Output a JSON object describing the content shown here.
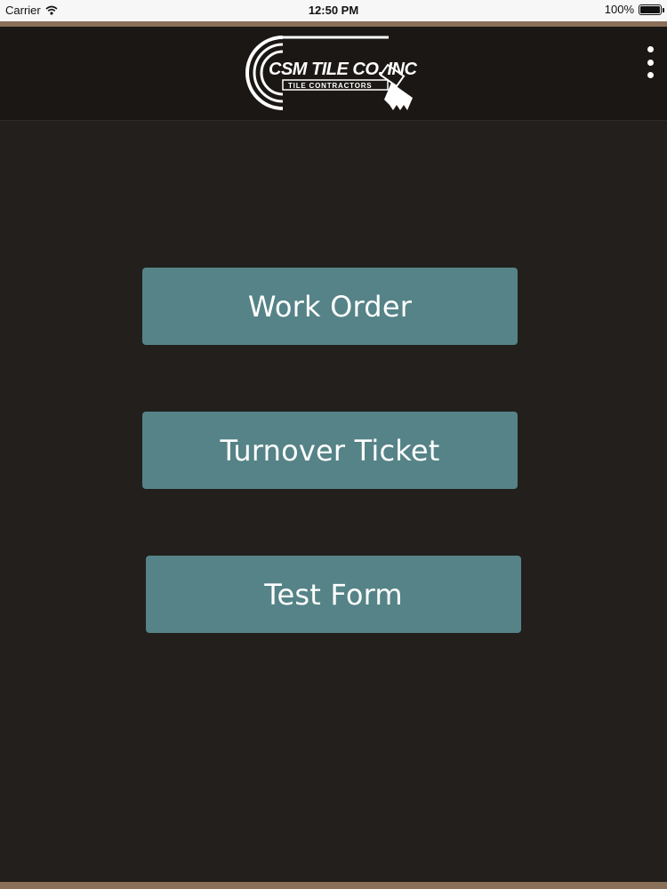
{
  "status_bar": {
    "carrier": "Carrier",
    "time": "12:50 PM",
    "battery": "100%",
    "battery_level": 1.0
  },
  "header": {
    "logo": {
      "company": "CSM TILE CO. INC",
      "tagline": "TILE CONTRACTORS"
    },
    "menu_icon": "more-vertical-icon"
  },
  "main": {
    "buttons": [
      {
        "label": "Work Order"
      },
      {
        "label": "Turnover Ticket"
      },
      {
        "label": "Test Form"
      }
    ]
  },
  "colors": {
    "background": "#221f1c",
    "header": "#1a1715",
    "accent_stripe": "#8a7058",
    "button": "#558387",
    "button_text": "#ffffff"
  }
}
